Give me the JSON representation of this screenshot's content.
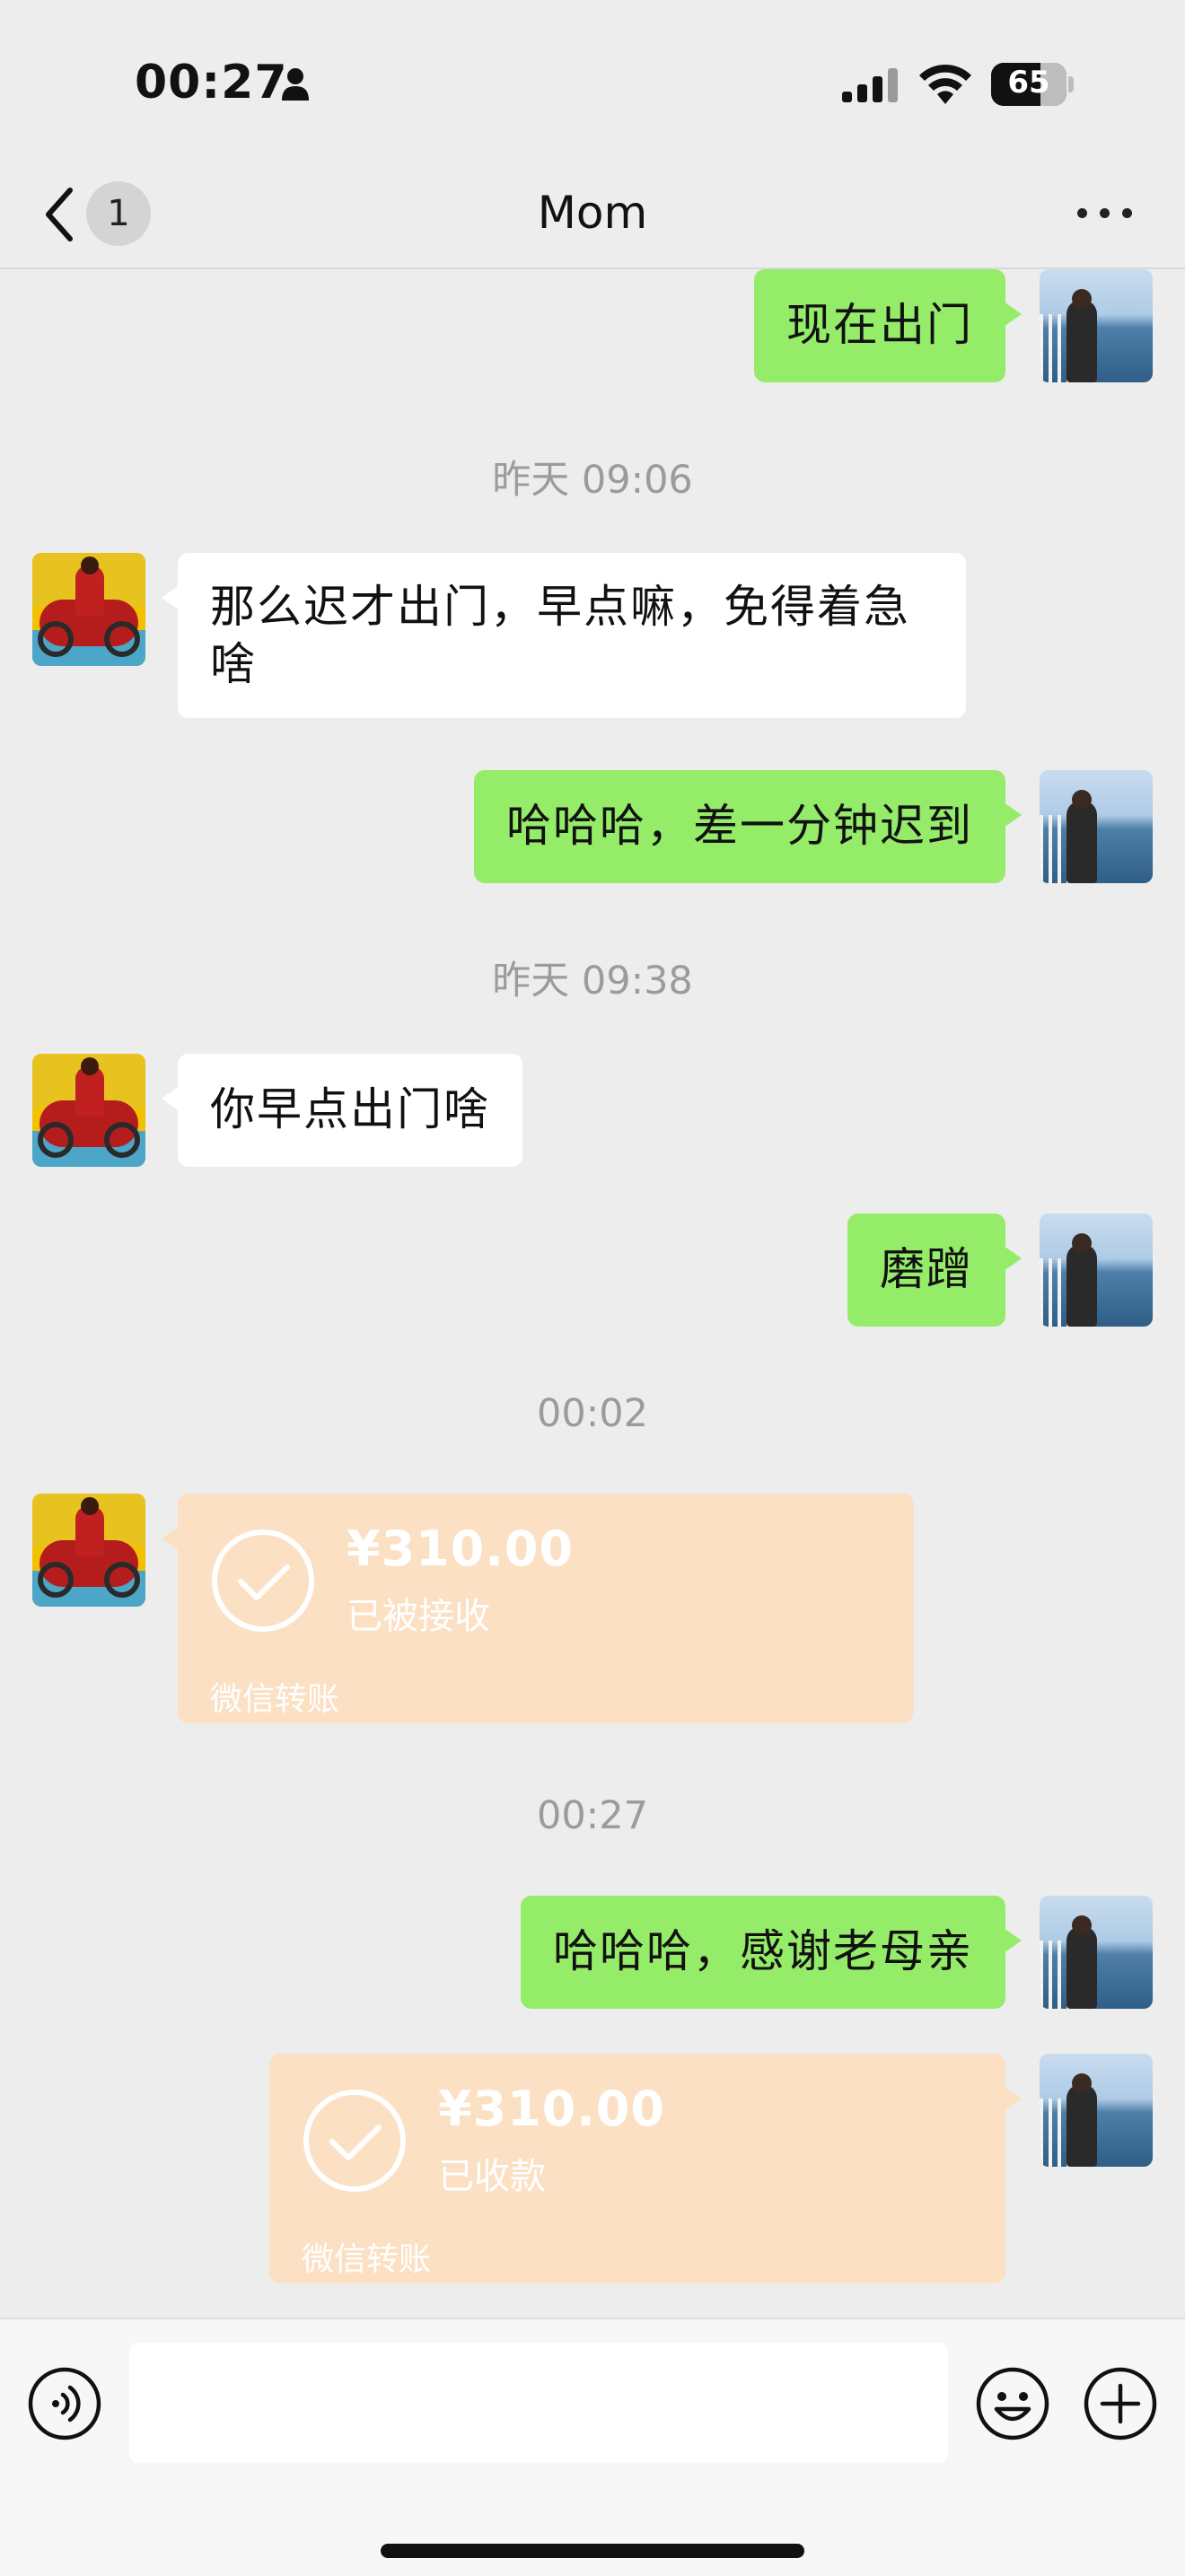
{
  "status_bar": {
    "time": "00:27",
    "battery": "65"
  },
  "header": {
    "unread_count": "1",
    "title": "Mom"
  },
  "messages": [
    {
      "type": "text",
      "side": "right",
      "text": "现在出门"
    },
    {
      "type": "timestamp",
      "text": "昨天 09:06"
    },
    {
      "type": "text",
      "side": "left",
      "text": "那么迟才出门，早点嘛，免得着急啥"
    },
    {
      "type": "text",
      "side": "right",
      "text": "哈哈哈，差一分钟迟到"
    },
    {
      "type": "timestamp",
      "text": "昨天 09:38"
    },
    {
      "type": "text",
      "side": "left",
      "text": "你早点出门啥"
    },
    {
      "type": "text",
      "side": "right",
      "text": "磨蹭"
    },
    {
      "type": "timestamp",
      "text": "00:02"
    },
    {
      "type": "transfer",
      "side": "left",
      "amount": "¥310.00",
      "status": "已被接收",
      "brand": "微信转账"
    },
    {
      "type": "timestamp",
      "text": "00:27"
    },
    {
      "type": "text",
      "side": "right",
      "text": "哈哈哈，感谢老母亲"
    },
    {
      "type": "transfer",
      "side": "right",
      "amount": "¥310.00",
      "status": "已收款",
      "brand": "微信转账"
    }
  ],
  "composer": {
    "placeholder": ""
  },
  "colors": {
    "background": "#ededed",
    "self_bubble": "#95ec69",
    "other_bubble": "#ffffff",
    "transfer_card": "#fbe0c4"
  },
  "icons": [
    "back-chevron-icon",
    "more-icon",
    "voice-icon",
    "emoji-icon",
    "plus-icon",
    "check-circle-icon"
  ]
}
